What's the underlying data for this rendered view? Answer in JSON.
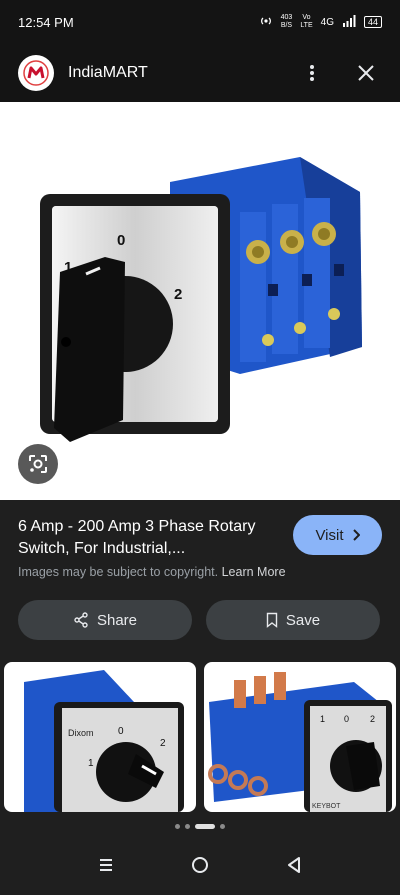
{
  "status": {
    "time": "12:54 PM",
    "speed_value": "403",
    "speed_unit": "B/S",
    "volte_top": "Vo",
    "volte_bottom": "LTE",
    "network": "4G",
    "battery": "44"
  },
  "header": {
    "site_name": "IndiaMART",
    "menu_icon": "more-vert-icon",
    "close_icon": "close-icon"
  },
  "result": {
    "title": "6 Amp - 200 Amp 3 Phase Rotary Switch, For Industrial,...",
    "visit_label": "Visit",
    "copyright_text": "Images may be subject to copyright.",
    "learn_more": "Learn More",
    "share_label": "Share",
    "save_label": "Save"
  },
  "switch_labels": {
    "zero": "0",
    "one": "1",
    "two": "2"
  },
  "thumb_left": {
    "brand": "Dixom",
    "zero": "0",
    "one": "1",
    "two": "2"
  },
  "thumb_right": {
    "zero": "0",
    "one": "1",
    "two": "2",
    "brand": "KEYBOT"
  },
  "pager": {
    "count": 4,
    "active": 1
  },
  "nav": {
    "recents_icon": "recents-icon",
    "home_icon": "home-icon",
    "back_icon": "back-icon"
  }
}
